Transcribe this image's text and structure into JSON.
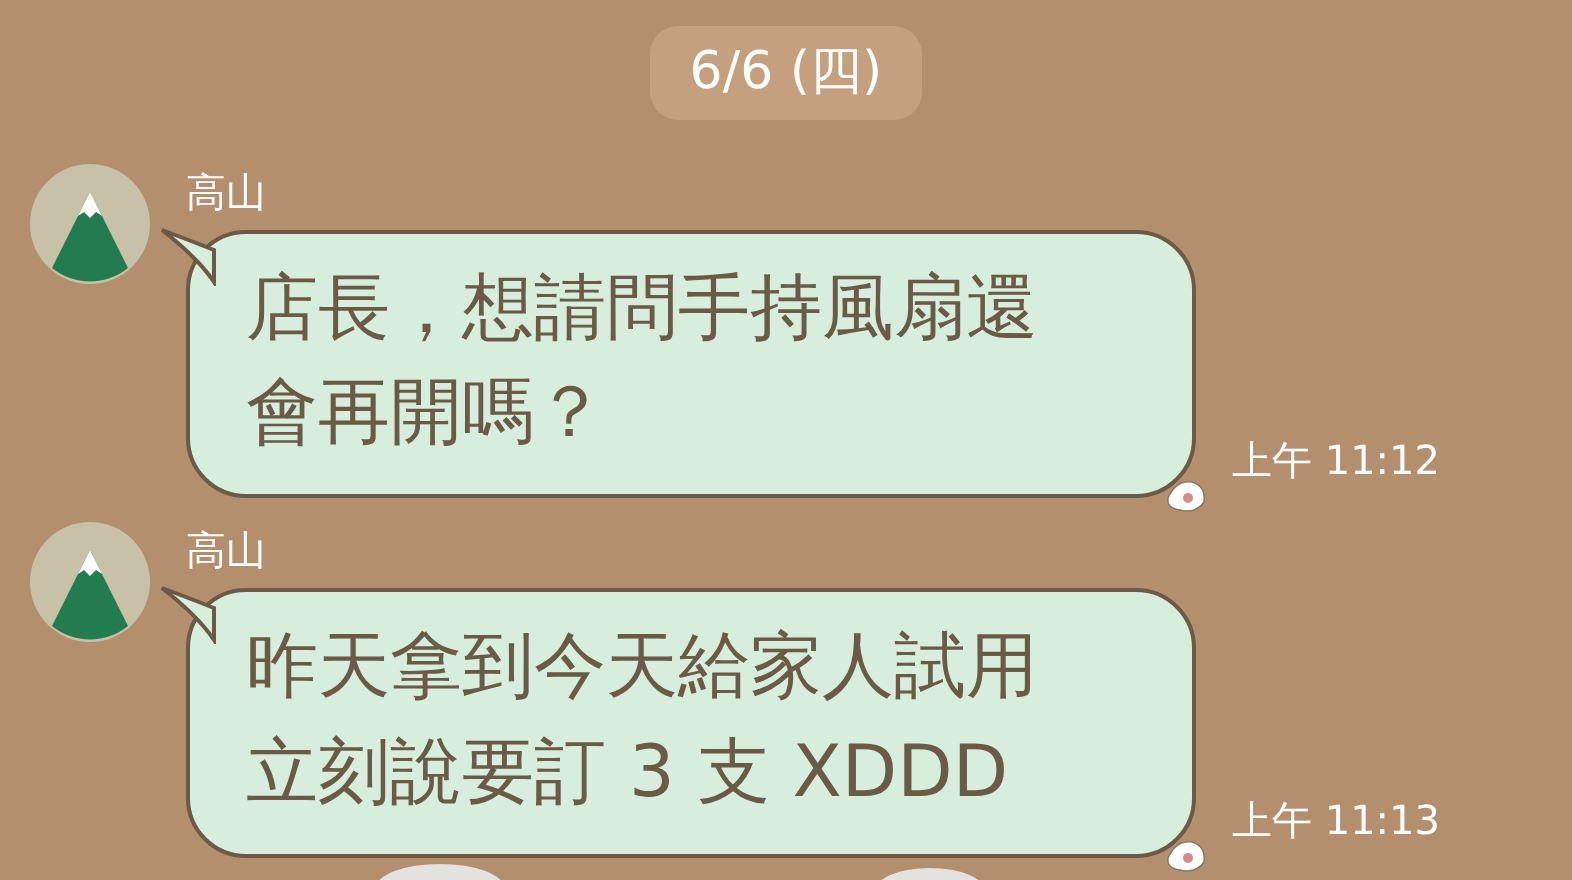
{
  "date_divider": "6/6 (四)",
  "messages": [
    {
      "sender": "高山",
      "lines": [
        "店長，想請問手持風扇還",
        "會再開嗎？"
      ],
      "time": "上午 11:12"
    },
    {
      "sender": "高山",
      "lines": [
        "昨天拿到今天給家人試用",
        "立刻說要訂 3 支 XDDD"
      ],
      "time": "上午 11:13"
    }
  ]
}
